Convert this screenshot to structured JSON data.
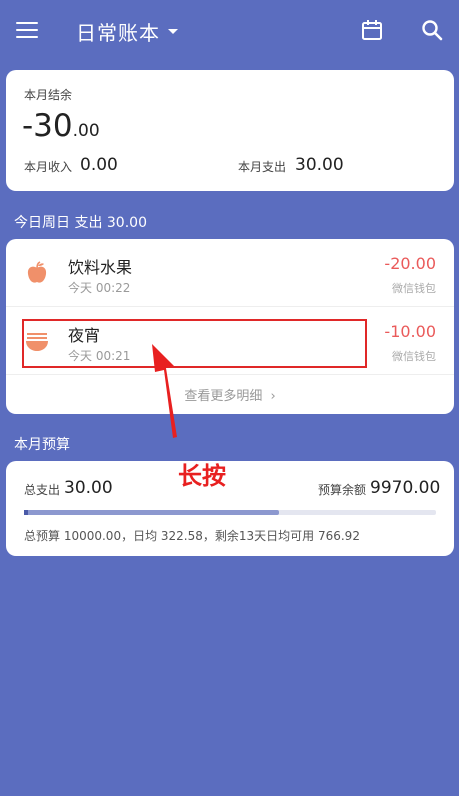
{
  "header": {
    "title": "日常账本",
    "menu_icon": "menu-icon",
    "calendar_icon": "calendar-icon",
    "search_icon": "search-icon"
  },
  "summary": {
    "balance_label": "本月结余",
    "balance_int": "-30",
    "balance_dec": ".00",
    "income_label": "本月收入",
    "income_value": "0.00",
    "expense_label": "本月支出",
    "expense_value": "30.00"
  },
  "today": {
    "heading": "今日周日  支出 30.00",
    "items": [
      {
        "name": "饮料水果",
        "time": "今天 00:22",
        "amount": "-20.00",
        "wallet": "微信钱包",
        "icon": "apple-icon"
      },
      {
        "name": "夜宵",
        "time": "今天 00:21",
        "amount": "-10.00",
        "wallet": "微信钱包",
        "icon": "noodle-bowl-icon"
      }
    ],
    "more_label": "查看更多明细"
  },
  "budget": {
    "heading": "本月预算",
    "total_label": "总支出",
    "total_value": "30.00",
    "remain_label": "预算余额",
    "remain_value": "9970.00",
    "progress": 0.62,
    "detail": "总预算 10000.00，日均 322.58，剩余13天日均可用 766.92"
  },
  "annotation": {
    "text": "长按"
  },
  "colors": {
    "background": "#5b6dbf",
    "expense_red": "#ea5a5a",
    "icon_orange": "#f0906a",
    "annotation_red": "#e02828"
  }
}
